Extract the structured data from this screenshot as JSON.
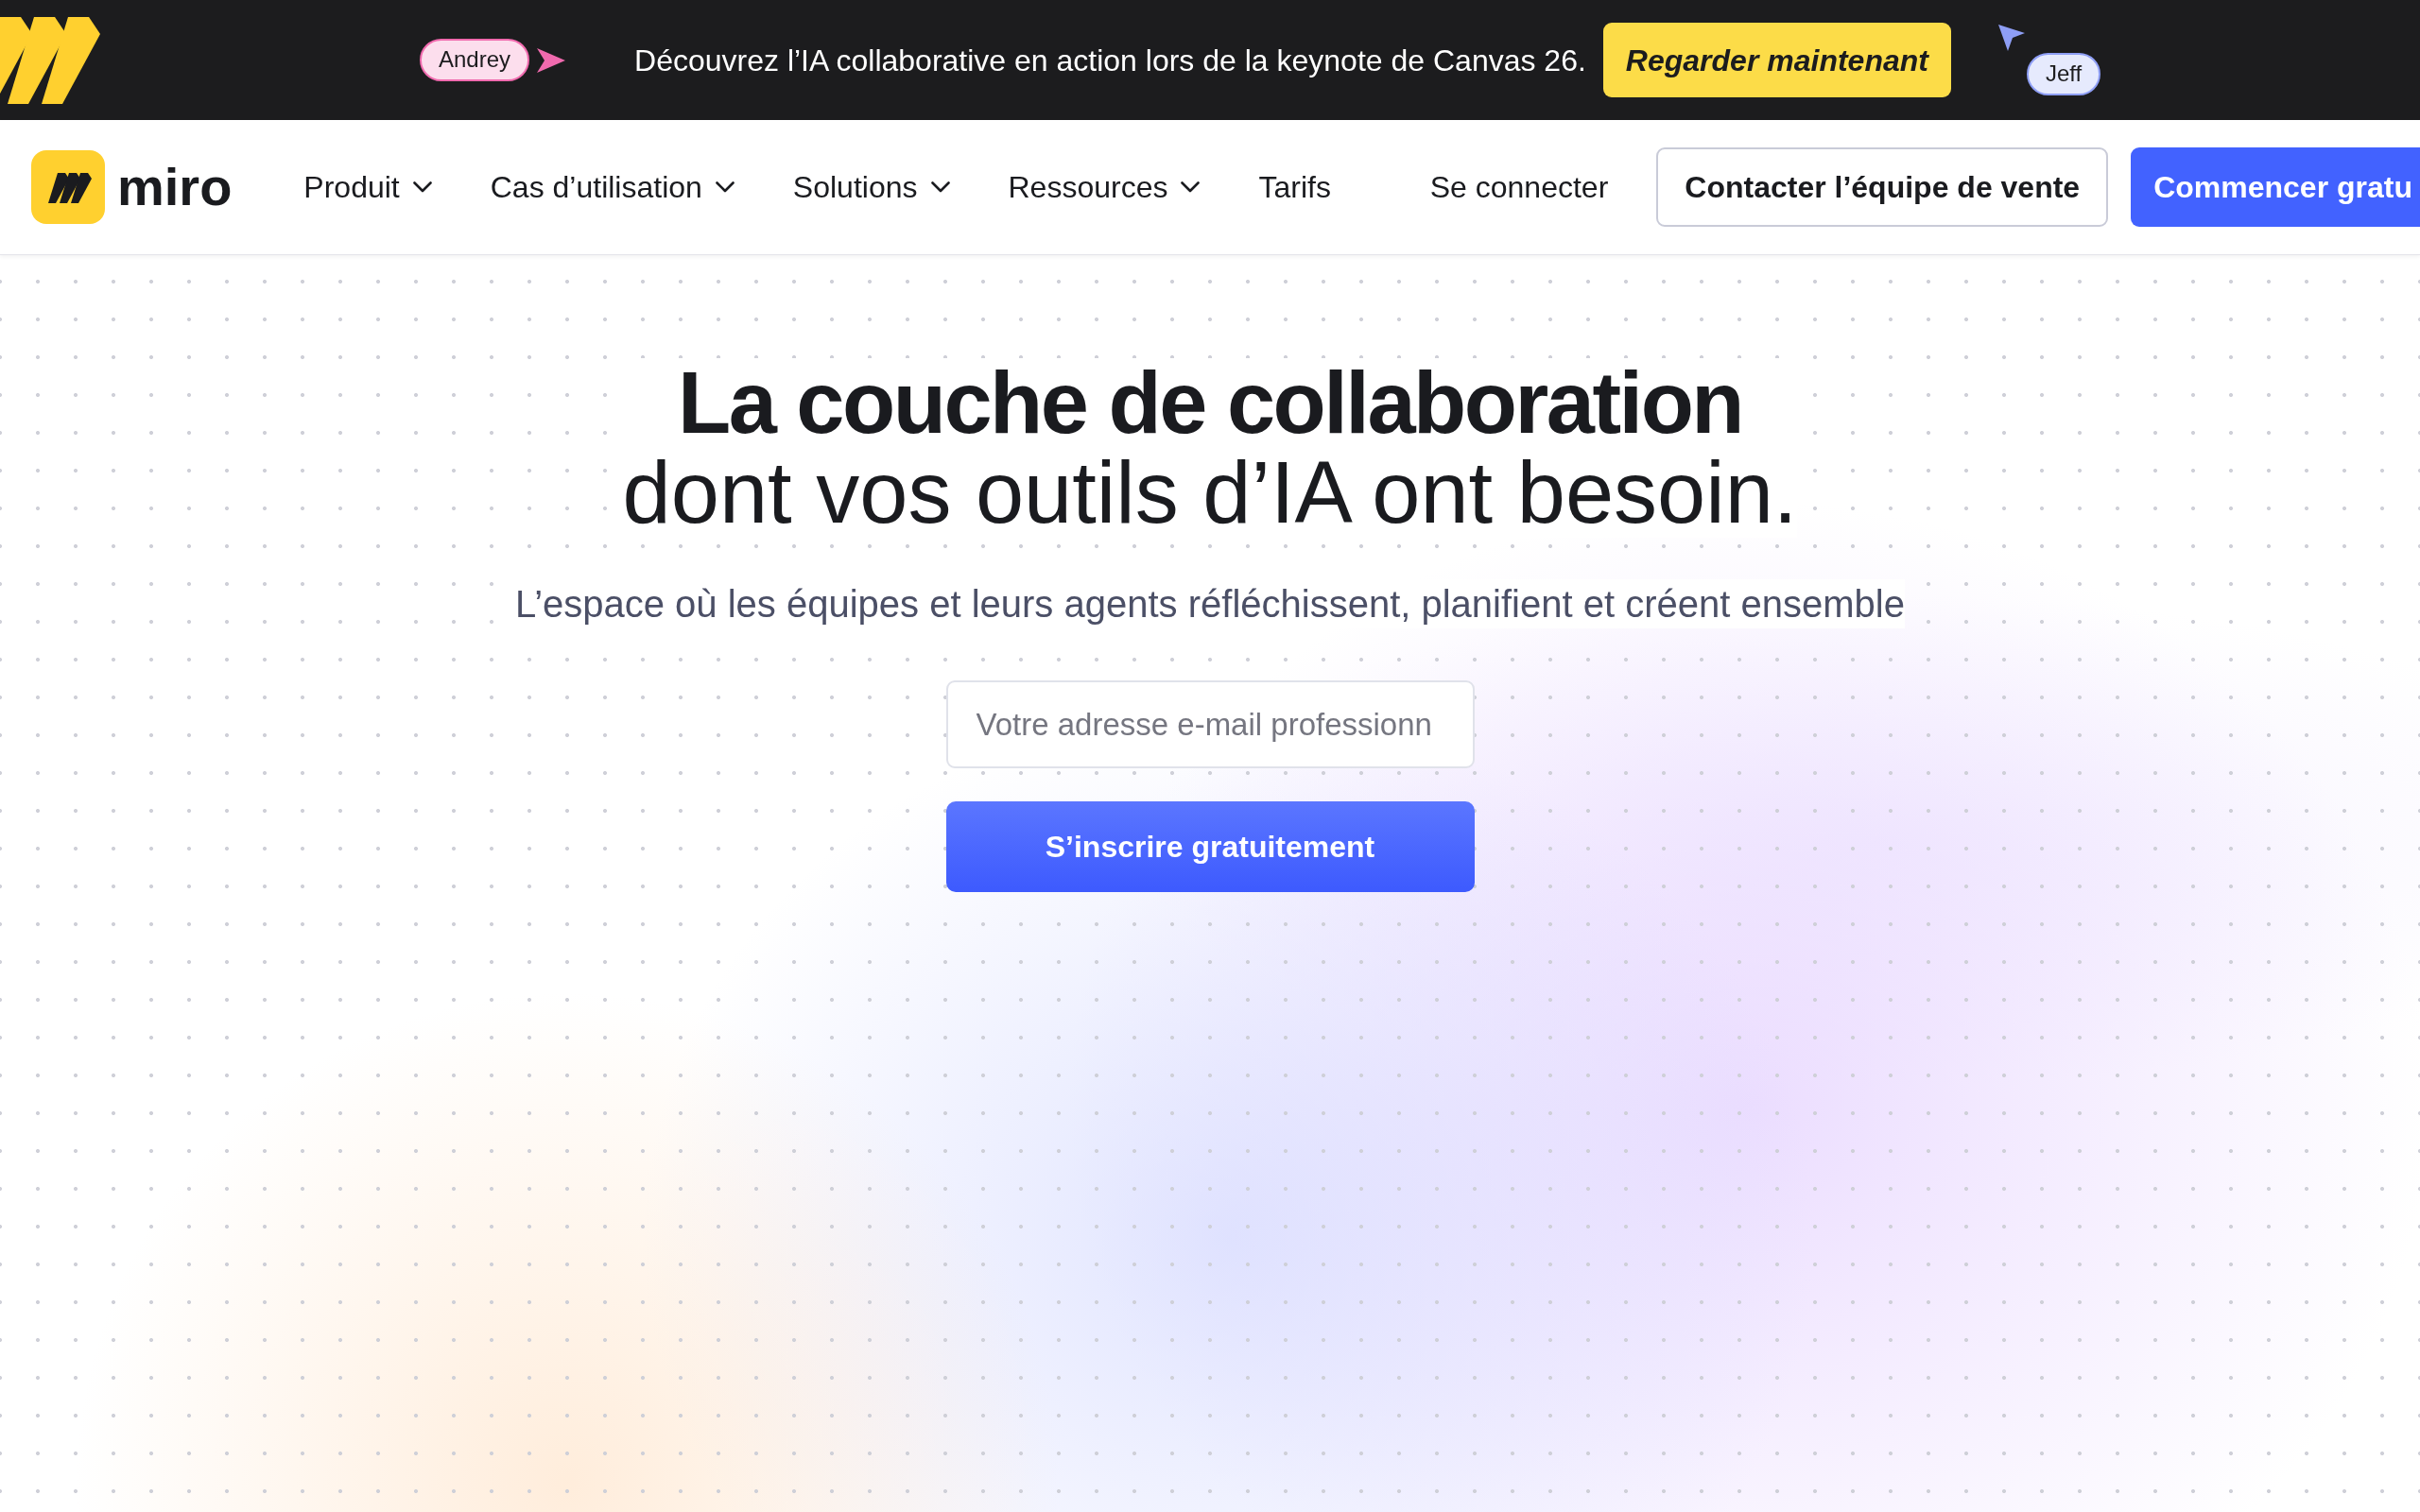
{
  "banner": {
    "collaborators": [
      {
        "name": "Andrey",
        "color": "#f06aae",
        "kind": "trailing"
      },
      {
        "name": "Jeff",
        "color": "#8e9ef5",
        "kind": "leading"
      }
    ],
    "message": "Découvrez l’IA collaborative en action lors de la keynote de Canvas 26.",
    "cta": "Regarder maintenant"
  },
  "navbar": {
    "brand": "miro",
    "items": [
      {
        "label": "Produit",
        "has_menu": true
      },
      {
        "label": "Cas d’utilisation",
        "has_menu": true
      },
      {
        "label": "Solutions",
        "has_menu": true
      },
      {
        "label": "Ressources",
        "has_menu": true
      },
      {
        "label": "Tarifs",
        "has_menu": false
      }
    ],
    "sign_in": "Se connecter",
    "contact_button": "Contacter l’équipe de vente",
    "start_button": "Commencer gratu"
  },
  "hero": {
    "title": "**La couche de collaboration** dont vos outils d’IA ont besoin.",
    "subtitle": "L’espace où les équipes et leurs agents réfléchissent, planifient et créent ensemble",
    "email_field": {
      "placeholder": "Votre adresse e-mail professionn"
    },
    "signup_button": "S’inscrire gratuitement"
  }
}
